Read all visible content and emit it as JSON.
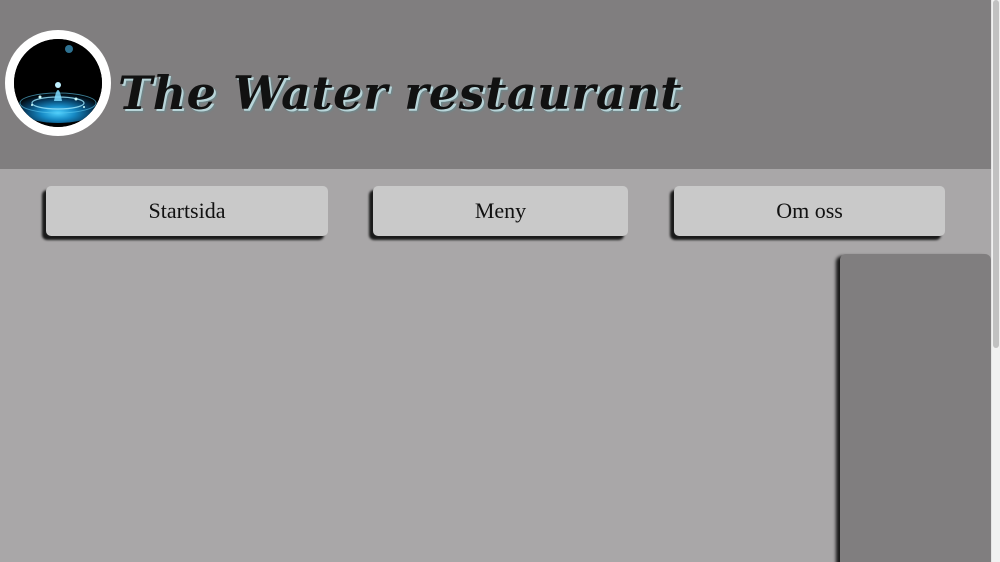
{
  "header": {
    "title": "The Water restaurant",
    "logo_icon": "water-drop-logo-icon",
    "background_color": "#807e7f"
  },
  "nav": {
    "items": [
      {
        "label": "Startsida"
      },
      {
        "label": "Meny"
      },
      {
        "label": "Om oss"
      }
    ],
    "button_color": "#c9c9c9"
  },
  "page": {
    "background_color": "#a9a7a8",
    "side_panel_color": "#807e7f"
  }
}
